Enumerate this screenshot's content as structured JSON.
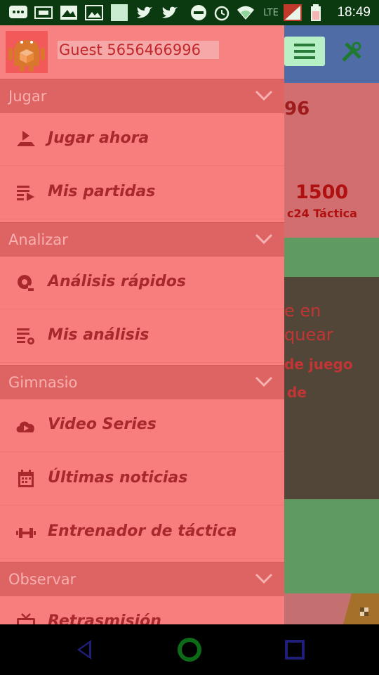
{
  "status_bar": {
    "time": "18:49",
    "network": "LTE",
    "icons": [
      "chat-icon",
      "game-icon",
      "image-icon",
      "photo-icon",
      "blank-icon",
      "twitter-icon",
      "twitter-icon",
      "minus-circle-icon",
      "alarm-icon",
      "wifi-icon",
      "signal-icon",
      "battery-icon"
    ]
  },
  "background_app": {
    "rating_value": "1500",
    "rating_label": "c24 Táctica",
    "partial_number": "96",
    "partial_text_1": "e en",
    "partial_text_2": "quear",
    "partial_text_3": "de juego",
    "partial_text_4": "de"
  },
  "drawer": {
    "user_name": "Guest 5656466996",
    "sections": [
      {
        "label": "Jugar",
        "items": [
          {
            "label": "Jugar ahora",
            "icon": "play-board-icon"
          },
          {
            "label": "Mis partidas",
            "icon": "list-play-icon"
          }
        ]
      },
      {
        "label": "Analizar",
        "items": [
          {
            "label": "Análisis rápidos",
            "icon": "analysis-icon"
          },
          {
            "label": "Mis análisis",
            "icon": "list-gear-icon"
          }
        ]
      },
      {
        "label": "Gimnasio",
        "items": [
          {
            "label": "Video Series",
            "icon": "cloud-play-icon"
          },
          {
            "label": "Últimas noticias",
            "icon": "calendar-icon"
          },
          {
            "label": "Entrenador de táctica",
            "icon": "dumbbell-icon"
          }
        ]
      },
      {
        "label": "Observar",
        "items": [
          {
            "label": "Retrasmisión",
            "icon": "tv-icon"
          }
        ]
      }
    ]
  },
  "colors": {
    "drawer_bg": "#f87d7d",
    "section_bg": "#de6464",
    "item_text": "#a8282b",
    "status_bar": "#0b3a10"
  }
}
